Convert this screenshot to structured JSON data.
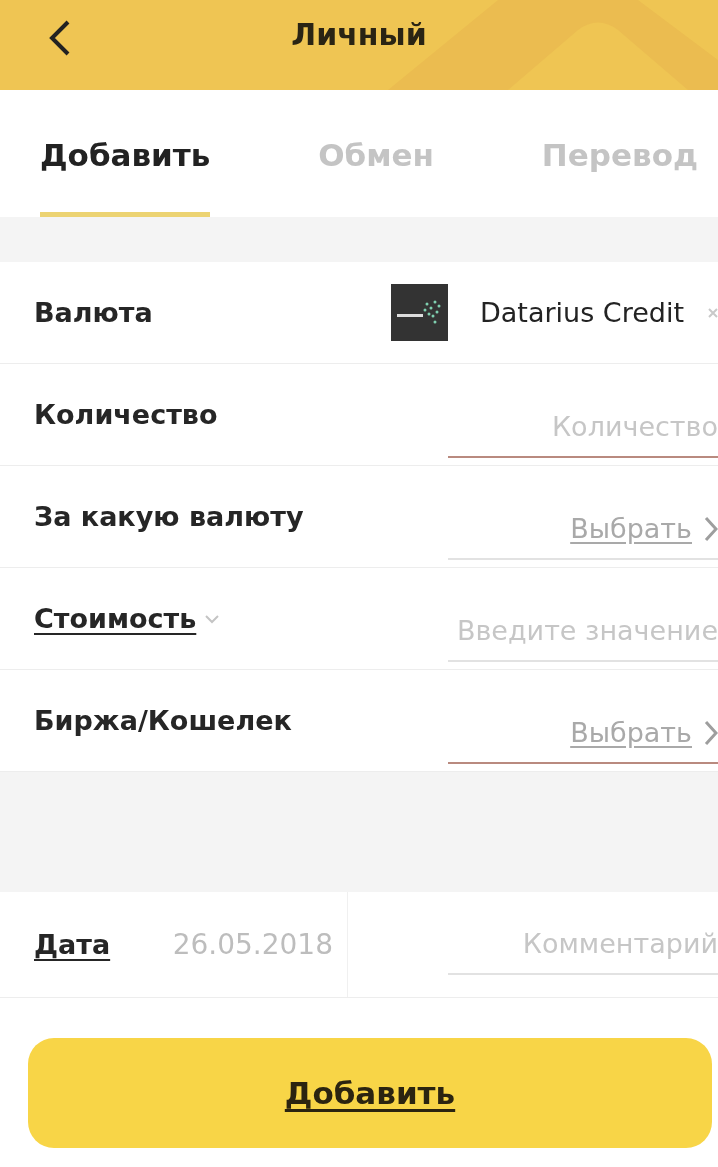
{
  "header": {
    "title": "Личный"
  },
  "tabs": [
    {
      "label": "Добавить",
      "selected": true
    },
    {
      "label": "Обмен",
      "selected": false
    },
    {
      "label": "Перевод",
      "selected": false
    }
  ],
  "rows": [
    {
      "kind": "currency",
      "label": "Валюта",
      "underlined": false,
      "value": "Datarius Credit"
    },
    {
      "kind": "input",
      "label": "Количество",
      "underlined": false,
      "placeholder": "Количество",
      "highlighted": true
    },
    {
      "kind": "select",
      "label": "За какую валюту",
      "underlined": false,
      "value": "Выбрать",
      "highlighted": false
    },
    {
      "kind": "input",
      "label": "Стоимость",
      "underlined": true,
      "dropdown": true,
      "placeholder": "Введите значение",
      "highlighted": false
    },
    {
      "kind": "select",
      "label": "Биржа/Кошелек",
      "underlined": false,
      "value": "Выбрать",
      "highlighted": true
    }
  ],
  "date_row": {
    "label": "Дата",
    "date": "26.05.2018",
    "comment_placeholder": "Комментарий"
  },
  "submit_button": "Добавить"
}
